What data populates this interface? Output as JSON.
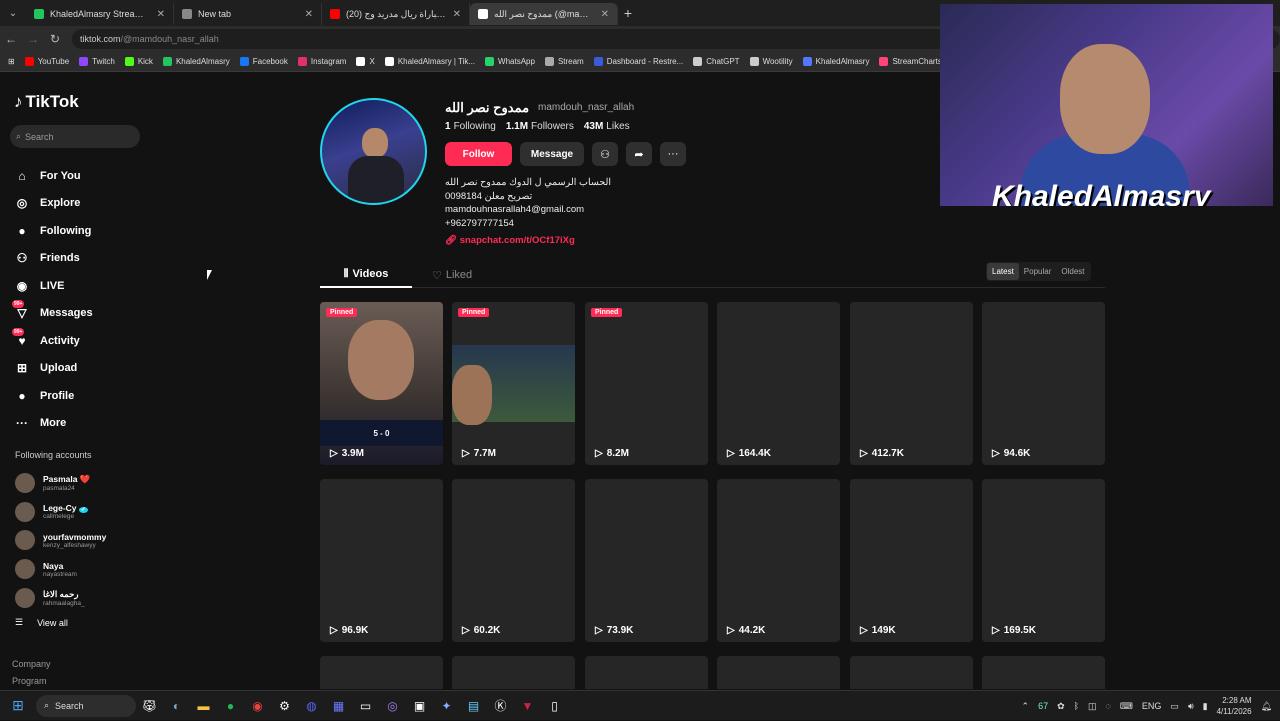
{
  "browser": {
    "tabs": [
      {
        "title": "KhaledAlmasry Stream - Watch",
        "color": "#22c55e",
        "active": false
      },
      {
        "title": "New tab",
        "color": "#888888",
        "active": false
      },
      {
        "title": "ملخص مباراة ريال مدريد وج (20)",
        "color": "#ff0000",
        "active": false
      },
      {
        "title": "ممدوح نصر الله (@mamdouh_nasr_allah)",
        "color": "#ffffff",
        "active": true
      }
    ],
    "url_domain": "tiktok.com",
    "url_path": "/@mamdouh_nasr_allah",
    "bookmarks": [
      {
        "label": "YouTube",
        "color": "#ff0000"
      },
      {
        "label": "Twitch",
        "color": "#9146ff"
      },
      {
        "label": "Kick",
        "color": "#53fc18"
      },
      {
        "label": "KhaledAlmasry",
        "color": "#22c55e"
      },
      {
        "label": "Facebook",
        "color": "#1877f2"
      },
      {
        "label": "Instagram",
        "color": "#e1306c"
      },
      {
        "label": "X",
        "color": "#ffffff"
      },
      {
        "label": "KhaledAlmasry | Tik...",
        "color": "#ffffff"
      },
      {
        "label": "WhatsApp",
        "color": "#25d366"
      },
      {
        "label": "Stream",
        "color": "#aaaaaa"
      },
      {
        "label": "Dashboard - Restre...",
        "color": "#3b5bdb"
      },
      {
        "label": "ChatGPT",
        "color": "#cccccc"
      },
      {
        "label": "Wootility",
        "color": "#cccccc"
      },
      {
        "label": "KhaledAlmasry",
        "color": "#5577ff"
      },
      {
        "label": "StreamCharts",
        "color": "#ff4477"
      }
    ]
  },
  "sidebar": {
    "logo": "TikTok",
    "search_placeholder": "Search",
    "nav": [
      {
        "label": "For You",
        "icon": "home-icon"
      },
      {
        "label": "Explore",
        "icon": "compass-icon"
      },
      {
        "label": "Following",
        "icon": "avatar-icon"
      },
      {
        "label": "Friends",
        "icon": "friends-icon"
      },
      {
        "label": "LIVE",
        "icon": "live-icon"
      },
      {
        "label": "Messages",
        "icon": "messages-icon",
        "badge": "99+"
      },
      {
        "label": "Activity",
        "icon": "activity-icon",
        "badge": "99+"
      },
      {
        "label": "Upload",
        "icon": "upload-icon"
      },
      {
        "label": "Profile",
        "icon": "profile-icon"
      },
      {
        "label": "More",
        "icon": "more-icon"
      }
    ],
    "following_title": "Following accounts",
    "following": [
      {
        "name": "Pasmala",
        "user": "pasmala24",
        "heart": "❤️"
      },
      {
        "name": "Lege-Cy",
        "user": "callmelege",
        "verified": "✓"
      },
      {
        "name": "yourfavmommy",
        "user": "kenzy_alfeshawyy"
      },
      {
        "name": "Naya",
        "user": "nayastream"
      },
      {
        "name": "رحمه الاغا",
        "user": "rahmaalagha_"
      }
    ],
    "view_all": "View all",
    "footer": [
      "Company",
      "Program"
    ]
  },
  "profile": {
    "name": "ممدوح نصر الله",
    "username": "mamdouh_nasr_allah",
    "following_count": "1",
    "following_label": "Following",
    "followers_count": "1.1M",
    "followers_label": "Followers",
    "likes_count": "43M",
    "likes_label": "Likes",
    "follow_label": "Follow",
    "message_label": "Message",
    "bio": [
      "الحساب الرسمي ل الدوك ممدوح نصر الله",
      "تصريح معلن 0098184",
      "mamdouhnasrallah4@gmail.com",
      "+962797777154"
    ],
    "link": "snapchat.com/t/OCf17iXg"
  },
  "content_tabs": {
    "videos": "Videos",
    "liked": "Liked"
  },
  "sort": {
    "latest": "Latest",
    "popular": "Popular",
    "oldest": "Oldest"
  },
  "videos": [
    {
      "views": "3.9M",
      "pinned": "Pinned"
    },
    {
      "views": "7.7M",
      "pinned": "Pinned"
    },
    {
      "views": "8.2M",
      "pinned": "Pinned"
    },
    {
      "views": "164.4K"
    },
    {
      "views": "412.7K"
    },
    {
      "views": "94.6K"
    },
    {
      "views": "96.9K"
    },
    {
      "views": "60.2K"
    },
    {
      "views": "73.9K"
    },
    {
      "views": "44.2K"
    },
    {
      "views": "149K"
    },
    {
      "views": "169.5K"
    }
  ],
  "thumb_score": "5 - 0",
  "stream_overlay": {
    "name": "KhaledAlmasry"
  },
  "taskbar": {
    "search": "Search",
    "temp": "67",
    "lang": "ENG",
    "time": "2:28 AM",
    "date": "4/11/2026"
  }
}
